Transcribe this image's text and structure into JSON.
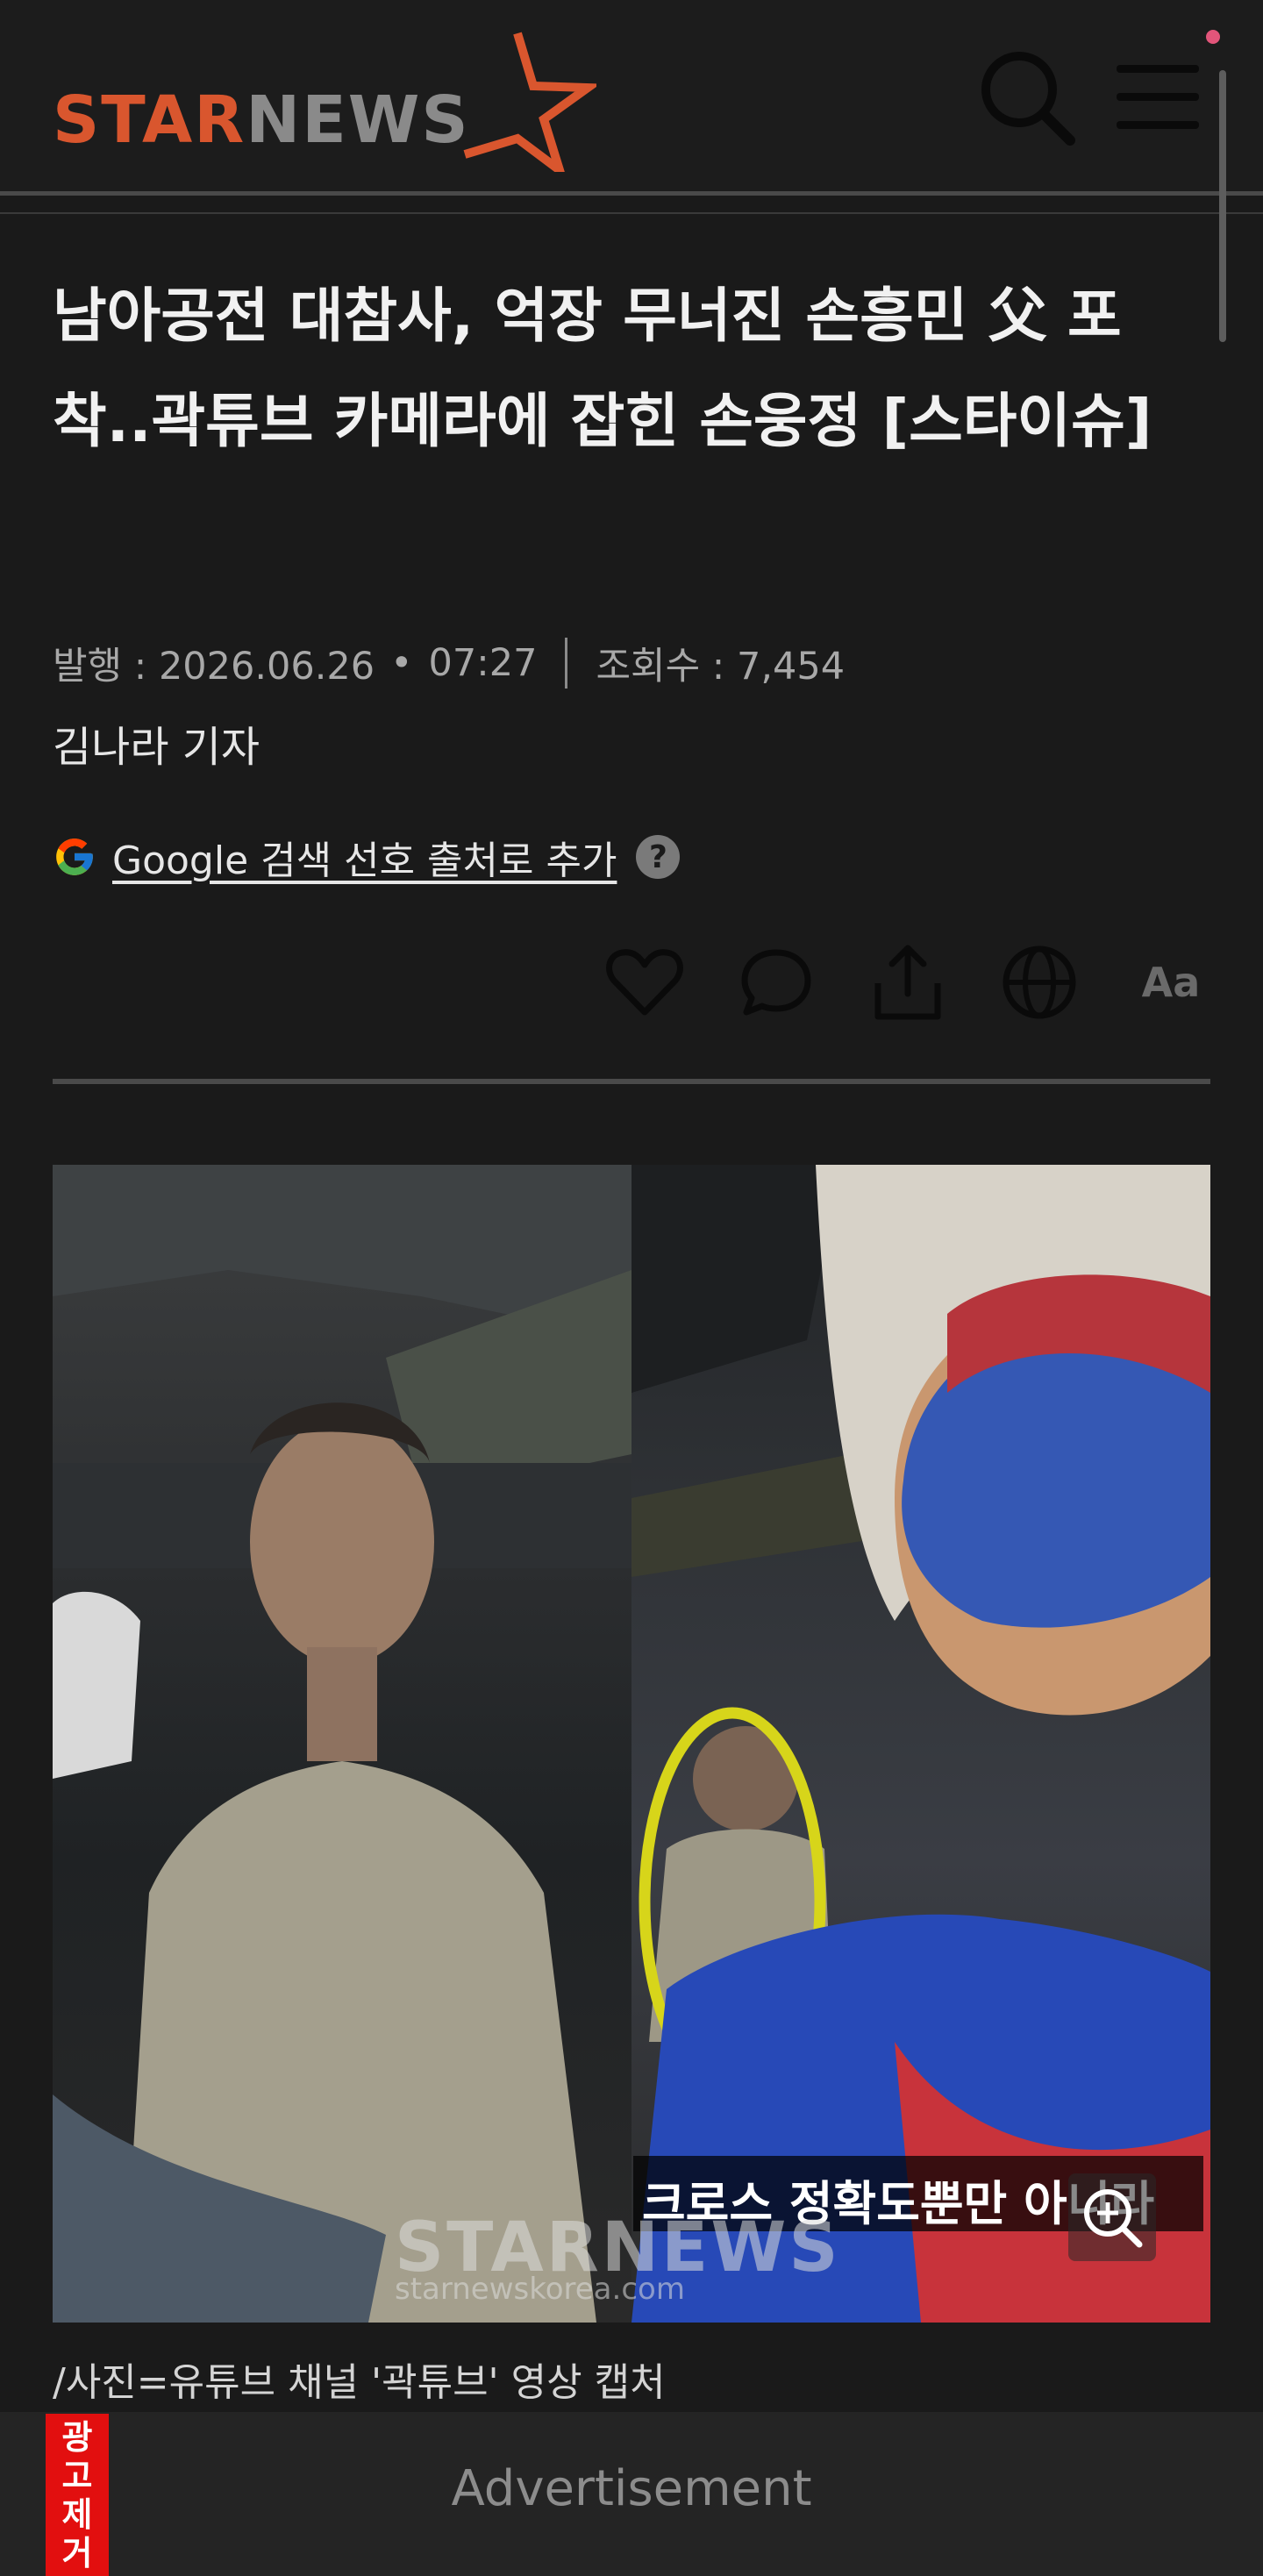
{
  "header": {
    "logo_text_1": "STAR",
    "logo_text_2": "NEWS",
    "logo_color": "#d9562e",
    "icons": [
      "search-icon",
      "hamburger-menu-icon"
    ]
  },
  "article": {
    "title": "남아공전 대참사, 억장 무너진 손흥민 父 포착..곽튜브 카메라에 잡힌 손웅정 [스타이슈]",
    "published_label": "발행 : 2026.06.26",
    "time": "07:27",
    "views_label": "조회수 : 7,454",
    "author": "김나라 기자"
  },
  "google": {
    "link_text": "Google 검색 선호 출처로 추가",
    "help": "?"
  },
  "actions": [
    "heart-icon",
    "comment-icon",
    "share-icon",
    "globe-icon",
    "font-size-icon"
  ],
  "font_icon_label": "Aa",
  "photo": {
    "overlay_caption": "크로스 정확도뿐만 아니라",
    "watermark": "STARNEWS",
    "watermark_url": "starnewskorea.com",
    "caption": "/사진=유튜브 채널 '곽튜브' 영상 캡처"
  },
  "ad": {
    "remove_label": [
      "광",
      "고",
      "제",
      "거"
    ],
    "text": "Advertisement"
  }
}
